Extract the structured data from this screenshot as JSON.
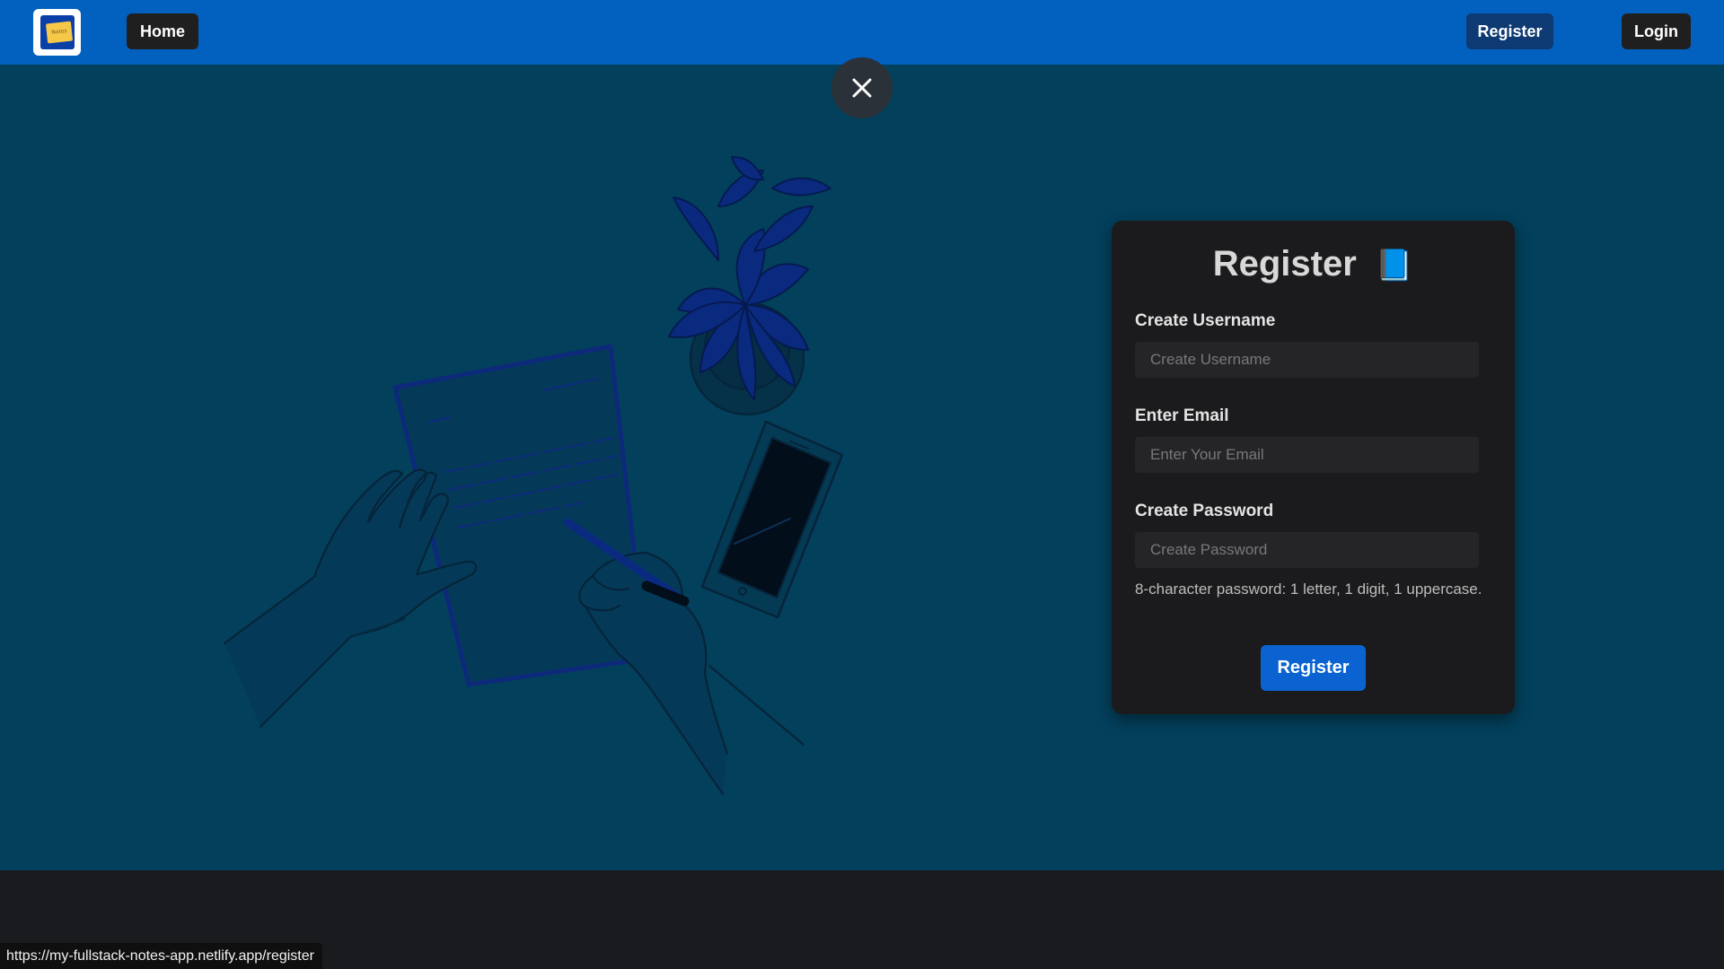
{
  "nav": {
    "logo_text": "Notes",
    "home_label": "Home",
    "register_label": "Register",
    "login_label": "Login"
  },
  "modal": {
    "close_icon": "close-icon"
  },
  "register_form": {
    "title": "Register",
    "title_emoji": "📘",
    "username_label": "Create Username",
    "username_placeholder": "Create Username",
    "email_label": "Enter Email",
    "email_placeholder": "Enter Your Email",
    "password_label": "Create Password",
    "password_placeholder": "Create Password",
    "password_hint": "8-character password: 1 letter, 1 digit, 1 uppercase.",
    "submit_label": "Register"
  },
  "status_bar": {
    "url": "https://my-fullstack-notes-app.netlify.app/register"
  },
  "colors": {
    "navbar": "#0260bf",
    "background": "#03405c",
    "card": "#1b1b1d",
    "primary_button": "#0a63d1",
    "illustration_accent": "#0a2a80"
  }
}
